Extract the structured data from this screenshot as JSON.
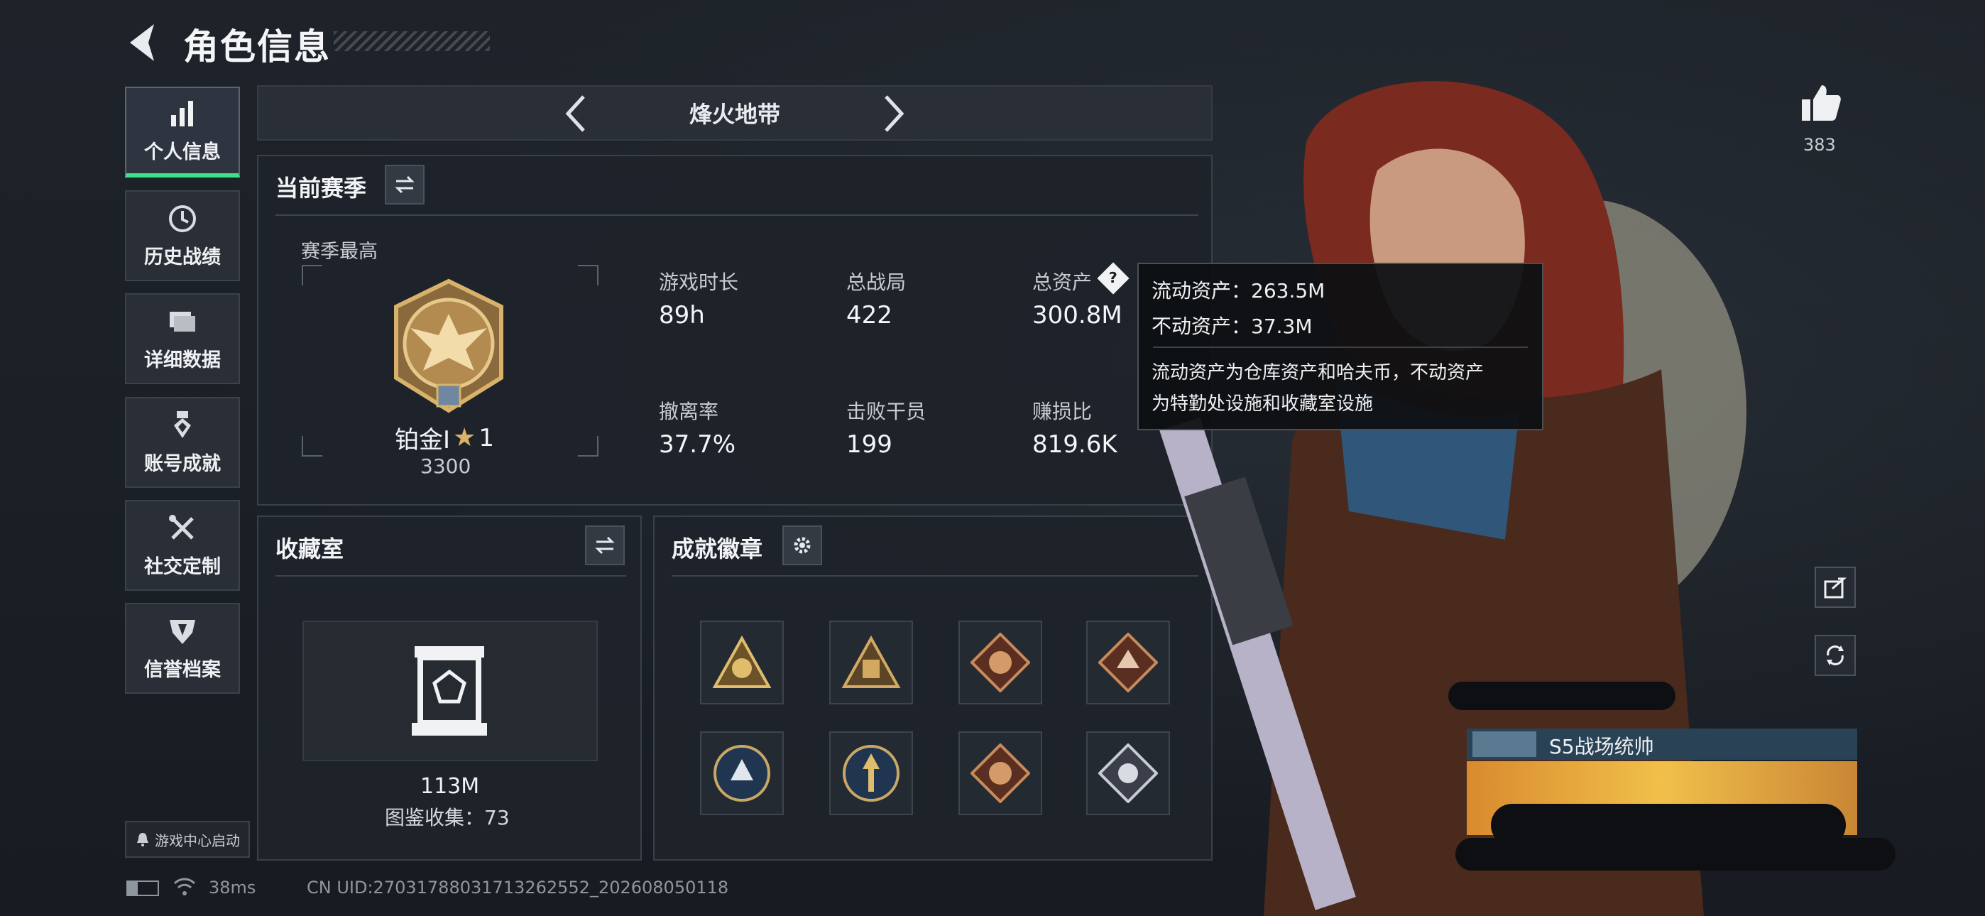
{
  "header": {
    "title": "角色信息"
  },
  "sidebar": {
    "items": [
      {
        "label": "个人信息",
        "icon": "bar-chart-icon",
        "active": true
      },
      {
        "label": "历史战绩",
        "icon": "history-icon",
        "active": false
      },
      {
        "label": "详细数据",
        "icon": "folder-icon",
        "active": false
      },
      {
        "label": "账号成就",
        "icon": "medal-icon",
        "active": false
      },
      {
        "label": "社交定制",
        "icon": "tools-icon",
        "active": false
      },
      {
        "label": "信誉档案",
        "icon": "shield-icon",
        "active": false
      }
    ],
    "game_center": "游戏中心启动"
  },
  "mode": {
    "title": "烽火地带"
  },
  "season": {
    "title": "当前赛季",
    "highest_label": "赛季最高",
    "rank_name": "铂金I",
    "rank_stars": "1",
    "rank_points": "3300",
    "stats": [
      {
        "label": "游戏时长",
        "value": "89h"
      },
      {
        "label": "总战局",
        "value": "422"
      },
      {
        "label": "总资产",
        "value": "300.8M"
      },
      {
        "label": "撤离率",
        "value": "37.7%"
      },
      {
        "label": "击败干员",
        "value": "199"
      },
      {
        "label": "赚损比",
        "value": "819.6K"
      }
    ]
  },
  "tooltip": {
    "liquid": "流动资产：263.5M",
    "fixed": "不动资产：37.3M",
    "desc_line1": "流动资产为仓库资产和哈夫币，不动资产",
    "desc_line2": "为特勤处设施和收藏室设施"
  },
  "collection": {
    "title": "收藏室",
    "value": "113M",
    "catalog": "图鉴收集：73"
  },
  "achievements": {
    "title": "成就徽章"
  },
  "likes": {
    "count": "383"
  },
  "banner": {
    "title": "S5战场统帅"
  },
  "status": {
    "ping": "38ms",
    "uid": "CN UID:27031788031713262552_202608050118"
  },
  "colors": {
    "accent": "#3ee08a",
    "gold": "#d8b26a"
  }
}
